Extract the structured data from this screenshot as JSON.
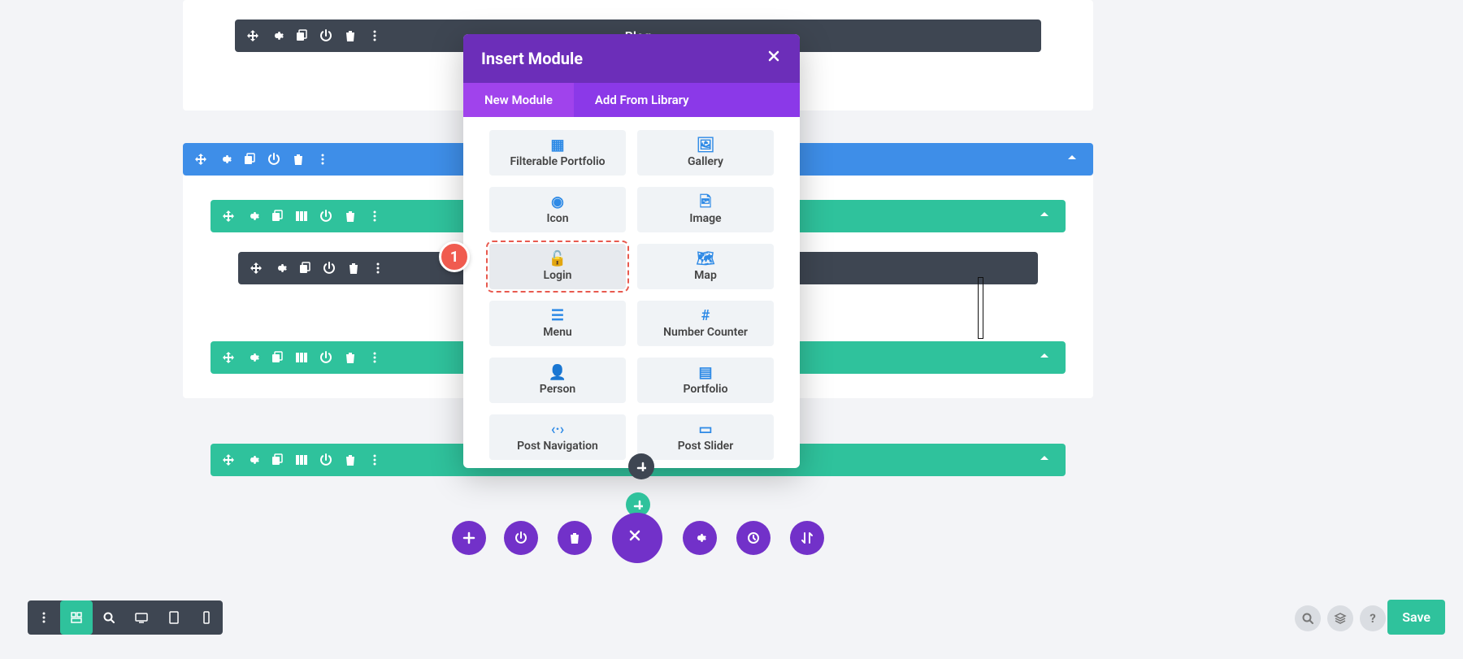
{
  "top_module_title": "Blog",
  "modal": {
    "title": "Insert Module",
    "tabs": {
      "new": "New Module",
      "library": "Add From Library"
    },
    "modules": [
      {
        "label": "Filterable Portfolio"
      },
      {
        "label": "Gallery"
      },
      {
        "label": "Icon"
      },
      {
        "label": "Image"
      },
      {
        "label": "Login",
        "highlight": true
      },
      {
        "label": "Map"
      },
      {
        "label": "Menu"
      },
      {
        "label": "Number Counter"
      },
      {
        "label": "Person"
      },
      {
        "label": "Portfolio"
      },
      {
        "label": "Post Navigation"
      },
      {
        "label": "Post Slider"
      }
    ]
  },
  "annotation": "1",
  "save_label": "Save",
  "colors": {
    "purple": "#7231c9",
    "green": "#2fc29c",
    "blue": "#3e8ee8",
    "dark": "#3e4652",
    "red": "#f05b4f"
  }
}
